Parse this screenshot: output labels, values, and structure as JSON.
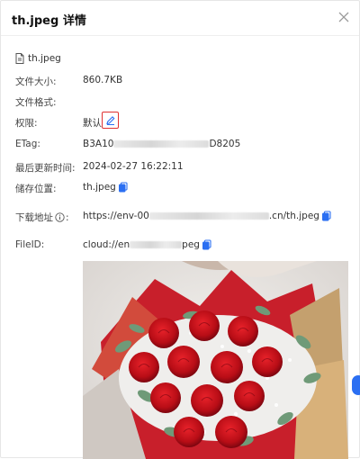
{
  "header": {
    "title": "th.jpeg 详情"
  },
  "file": {
    "name": "th.jpeg"
  },
  "fields": {
    "size_label": "文件大小:",
    "size_value": "860.7KB",
    "format_label": "文件格式:",
    "permission_label": "权限:",
    "permission_value": "默认",
    "etag_label": "ETag:",
    "etag_prefix": "B3A10",
    "etag_suffix": "D8205",
    "modified_label": "最后更新时间:",
    "modified_value": "2024-02-27 16:22:11",
    "location_label": "储存位置:",
    "location_value": "th.jpeg",
    "download_label": "下载地址",
    "download_prefix": "https://env-00",
    "download_suffix": ".cn/th.jpeg",
    "fileid_label": "FileID:",
    "fileid_prefix": "cloud://en",
    "fileid_suffix": "peg"
  },
  "icons": {
    "close": "close-icon",
    "file": "file-icon",
    "edit": "edit-icon",
    "copy": "copy-icon",
    "info": "info-icon"
  },
  "colors": {
    "accent": "#2b6ff2",
    "highlight": "#e03131"
  }
}
